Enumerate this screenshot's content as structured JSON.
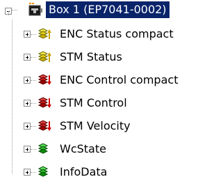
{
  "tree": {
    "root": {
      "label": "Box 1 (EP7041-0002)",
      "expanded": true,
      "selected": true,
      "icon": "ethercat-box-icon"
    },
    "children": [
      {
        "label": "ENC Status compact",
        "icon": "input-process-data-icon",
        "expanded": false
      },
      {
        "label": "STM Status",
        "icon": "input-process-data-icon",
        "expanded": false
      },
      {
        "label": "ENC Control compact",
        "icon": "output-process-data-icon",
        "expanded": false
      },
      {
        "label": "STM Control",
        "icon": "output-process-data-icon",
        "expanded": false
      },
      {
        "label": "STM Velocity",
        "icon": "output-process-data-icon",
        "expanded": false
      },
      {
        "label": "WcState",
        "icon": "status-data-icon",
        "expanded": false
      },
      {
        "label": "InfoData",
        "icon": "status-data-icon",
        "expanded": false
      }
    ]
  }
}
